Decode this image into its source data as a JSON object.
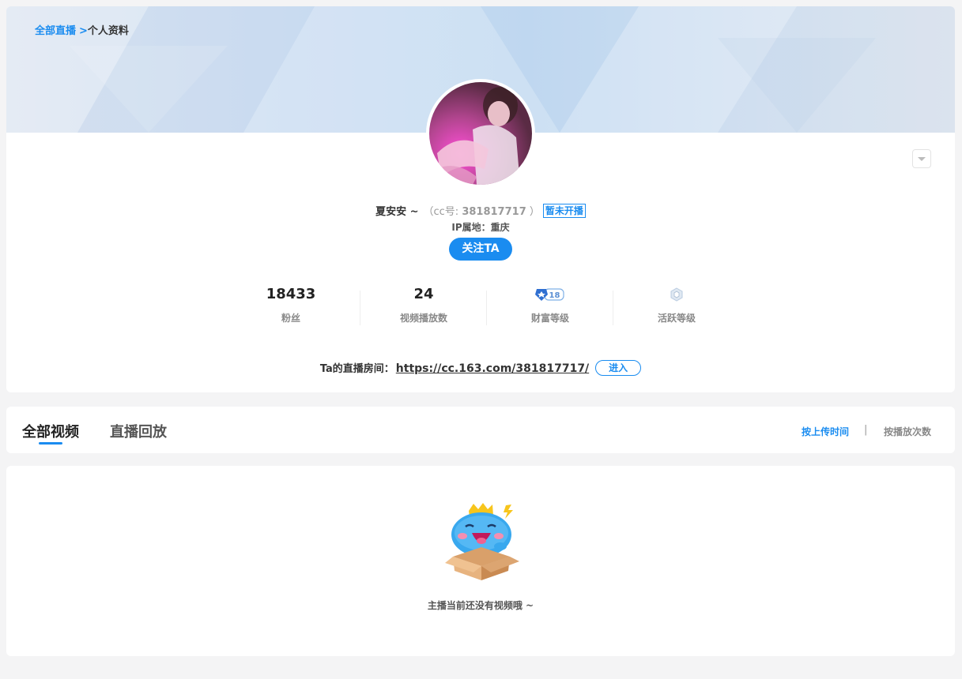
{
  "breadcrumb": {
    "link": "全部直播",
    "sep": ">",
    "current": "个人资料"
  },
  "profile": {
    "nickname": "夏安安 ~",
    "cc_label": "（cc号: ",
    "cc_number": "381817717",
    "cc_close": " ）",
    "live_status": "暂未开播",
    "ip_location": "IP属地：重庆",
    "follow_label": "关注TA"
  },
  "stats": [
    {
      "value": "18433",
      "label": "粉丝"
    },
    {
      "value": "24",
      "label": "视频播放数"
    },
    {
      "icon": "wealth-level-badge-icon",
      "badge_text": "18",
      "label": "财富等级"
    },
    {
      "icon": "activity-level-badge-icon",
      "label": "活跃等级"
    }
  ],
  "room": {
    "label": "Ta的直播房间：",
    "url": "https://cc.163.com/381817717/",
    "enter_label": "进入"
  },
  "tabs": [
    {
      "label": "全部视频",
      "active": true
    },
    {
      "label": "直播回放",
      "active": false
    }
  ],
  "sort": {
    "by_upload": "按上传时间",
    "separator": "|",
    "by_plays": "按播放次数"
  },
  "empty": {
    "message": "主播当前还没有视频哦 ~",
    "icon": "empty-box-mascot-icon"
  },
  "colors": {
    "accent": "#1a8cf0",
    "page_bg": "#f4f4f5"
  }
}
